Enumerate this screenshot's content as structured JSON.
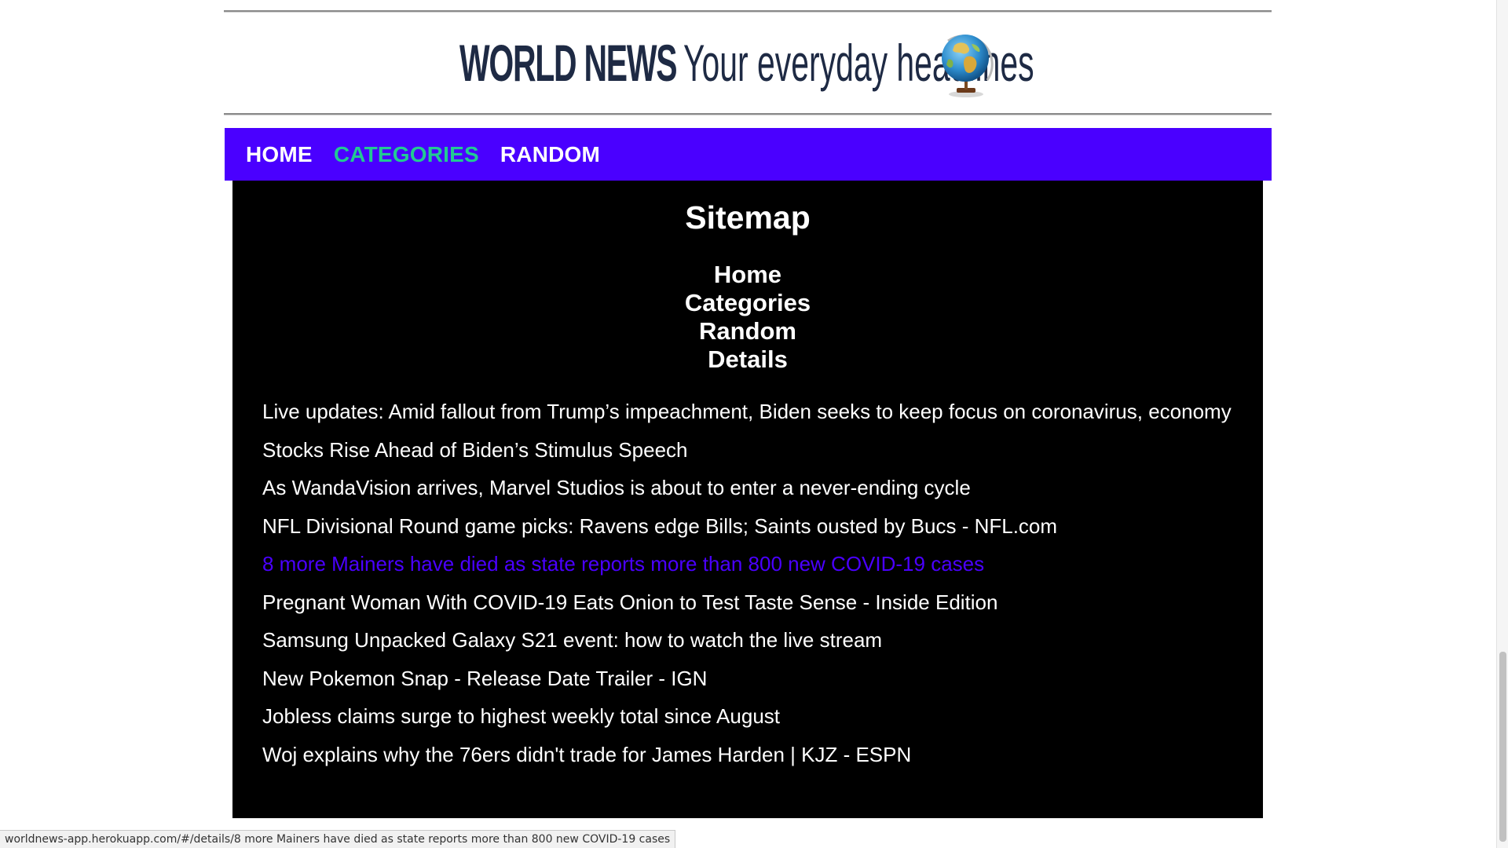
{
  "header": {
    "logo_bold": "WORLD NEWS",
    "logo_tagline": "Your everyday headlines",
    "logo_icon": "globe-icon"
  },
  "nav": {
    "items": [
      {
        "label": "HOME"
      },
      {
        "label": "CATEGORIES"
      },
      {
        "label": "RANDOM"
      }
    ],
    "active": "CATEGORIES",
    "background": "#4a00ff",
    "active_color": "#22c993"
  },
  "sitemap": {
    "title": "Sitemap",
    "links": [
      "Home",
      "Categories",
      "Random",
      "Details"
    ]
  },
  "headlines": [
    "Live updates: Amid fallout from Trump’s impeachment, Biden seeks to keep focus on coronavirus, economy",
    "Stocks Rise Ahead of Biden’s Stimulus Speech",
    "As WandaVision arrives, Marvel Studios is about to enter a never-ending cycle",
    "NFL Divisional Round game picks: Ravens edge Bills; Saints ousted by Bucs - NFL.com",
    "8 more Mainers have died as state reports more than 800 new COVID-19 cases",
    "Pregnant Woman With COVID-19 Eats Onion to Test Taste Sense - Inside Edition",
    "Samsung Unpacked Galaxy S21 event: how to watch the live stream",
    "New Pokemon Snap - Release Date Trailer - IGN",
    "Jobless claims surge to highest weekly total since August",
    "Woj explains why the 76ers didn't trade for James Harden | KJZ - ESPN"
  ],
  "hovered_headline_color": "#4a00ff",
  "status_bar": {
    "url": "worldnews-app.herokuapp.com/#/details/8 more Mainers have died as state reports more than 800 new COVID-19 cases"
  }
}
